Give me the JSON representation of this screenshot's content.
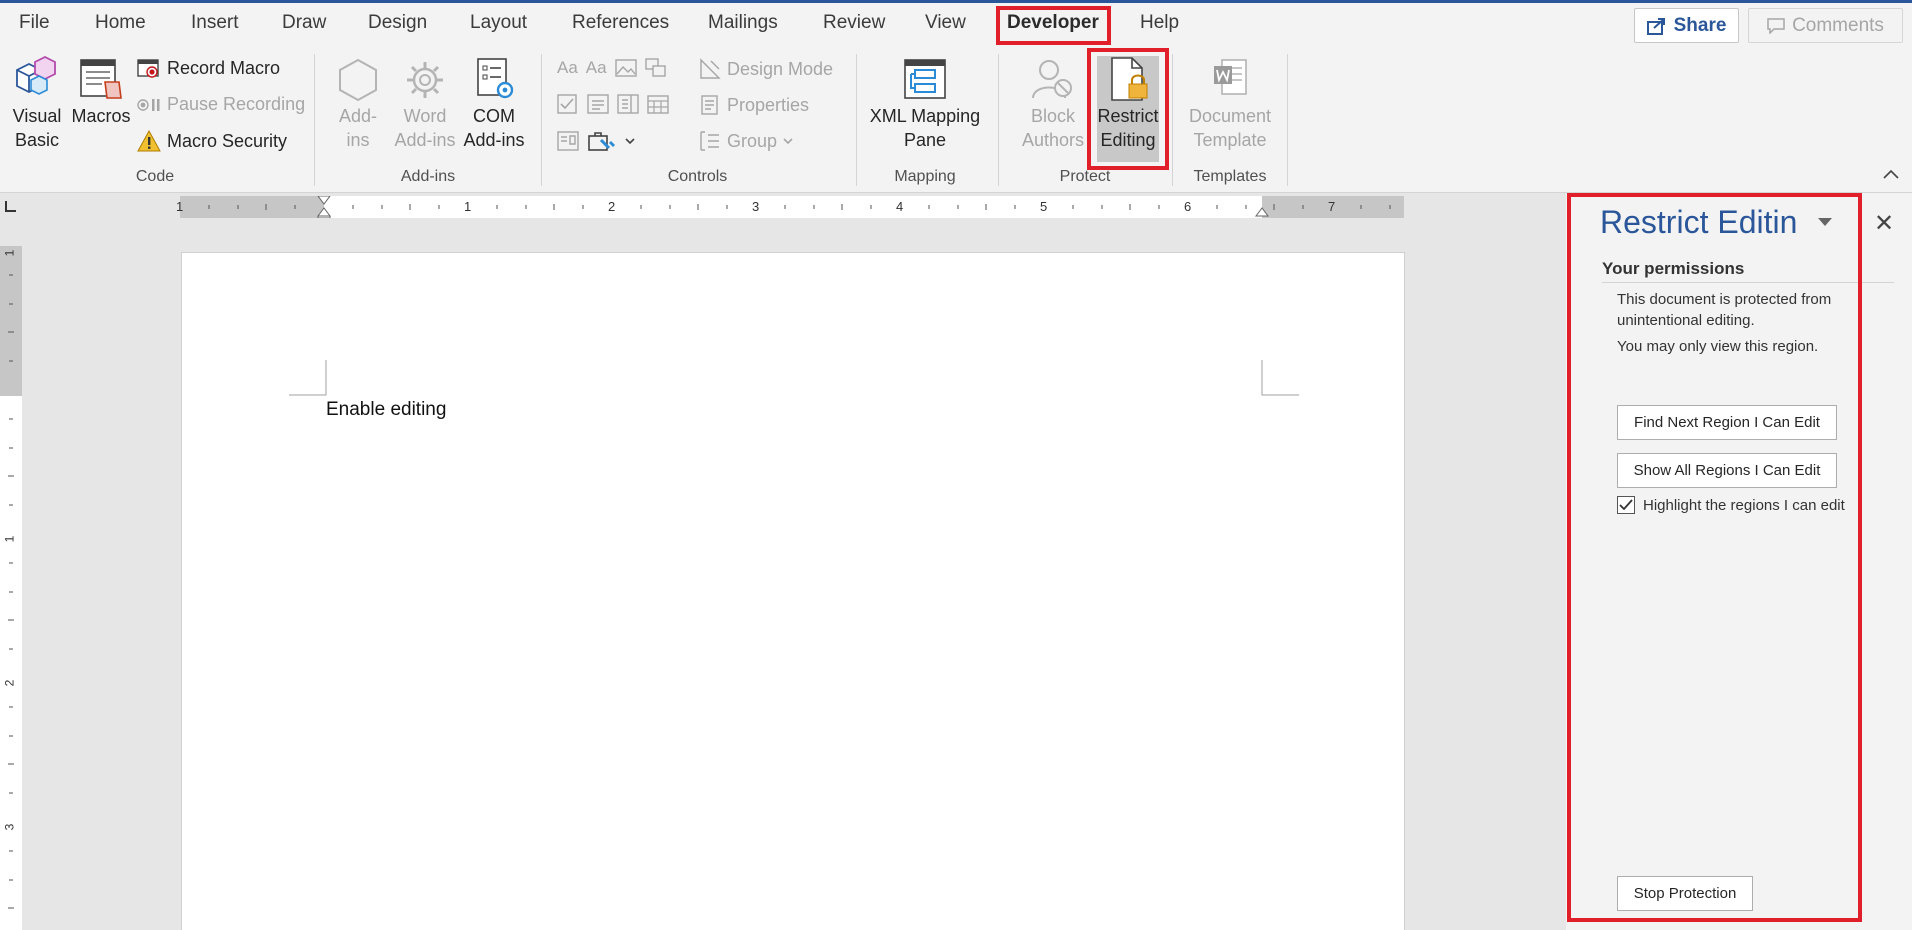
{
  "tabs": [
    "File",
    "Home",
    "Insert",
    "Draw",
    "Design",
    "Layout",
    "References",
    "Mailings",
    "Review",
    "View",
    "Developer",
    "Help"
  ],
  "active_tab": "Developer",
  "share_label": "Share",
  "comments_label": "Comments",
  "ribbon": {
    "code": {
      "visual_basic": [
        "Visual",
        "Basic"
      ],
      "macros": "Macros",
      "record_macro": "Record Macro",
      "pause_recording": "Pause Recording",
      "macro_security": "Macro Security",
      "label": "Code"
    },
    "addins": {
      "add_ins": [
        "Add-",
        "ins"
      ],
      "word_add_ins": [
        "Word",
        "Add-ins"
      ],
      "com_add_ins": [
        "COM",
        "Add-ins"
      ],
      "label": "Add-ins"
    },
    "controls": {
      "design_mode": "Design Mode",
      "properties": "Properties",
      "group": "Group",
      "label": "Controls"
    },
    "mapping": {
      "xml_mapping_pane": [
        "XML Mapping",
        "Pane"
      ],
      "label": "Mapping"
    },
    "protect": {
      "block_authors": [
        "Block",
        "Authors"
      ],
      "restrict_editing": [
        "Restrict",
        "Editing"
      ],
      "label": "Protect"
    },
    "templates": {
      "document_template": [
        "Document",
        "Template"
      ],
      "label": "Templates"
    }
  },
  "ruler": {
    "h_labels": [
      "1",
      "1",
      "2",
      "3",
      "4",
      "5",
      "6",
      "7"
    ],
    "v_labels": [
      "1",
      "1",
      "2",
      "3"
    ]
  },
  "document": {
    "text": "Enable editing"
  },
  "pane": {
    "title": "Restrict Editing",
    "heading": "Your permissions",
    "line1": "This document is protected from",
    "line2": "unintentional editing.",
    "line3": "You may only view this region.",
    "find_next": "Find Next Region I Can Edit",
    "show_all": "Show All Regions I Can Edit",
    "highlight": "Highlight the regions I can edit",
    "highlight_checked": true,
    "stop_protection": "Stop Protection"
  },
  "colors": {
    "accent": "#2b579a",
    "highlight_box": "#e01f2a"
  }
}
